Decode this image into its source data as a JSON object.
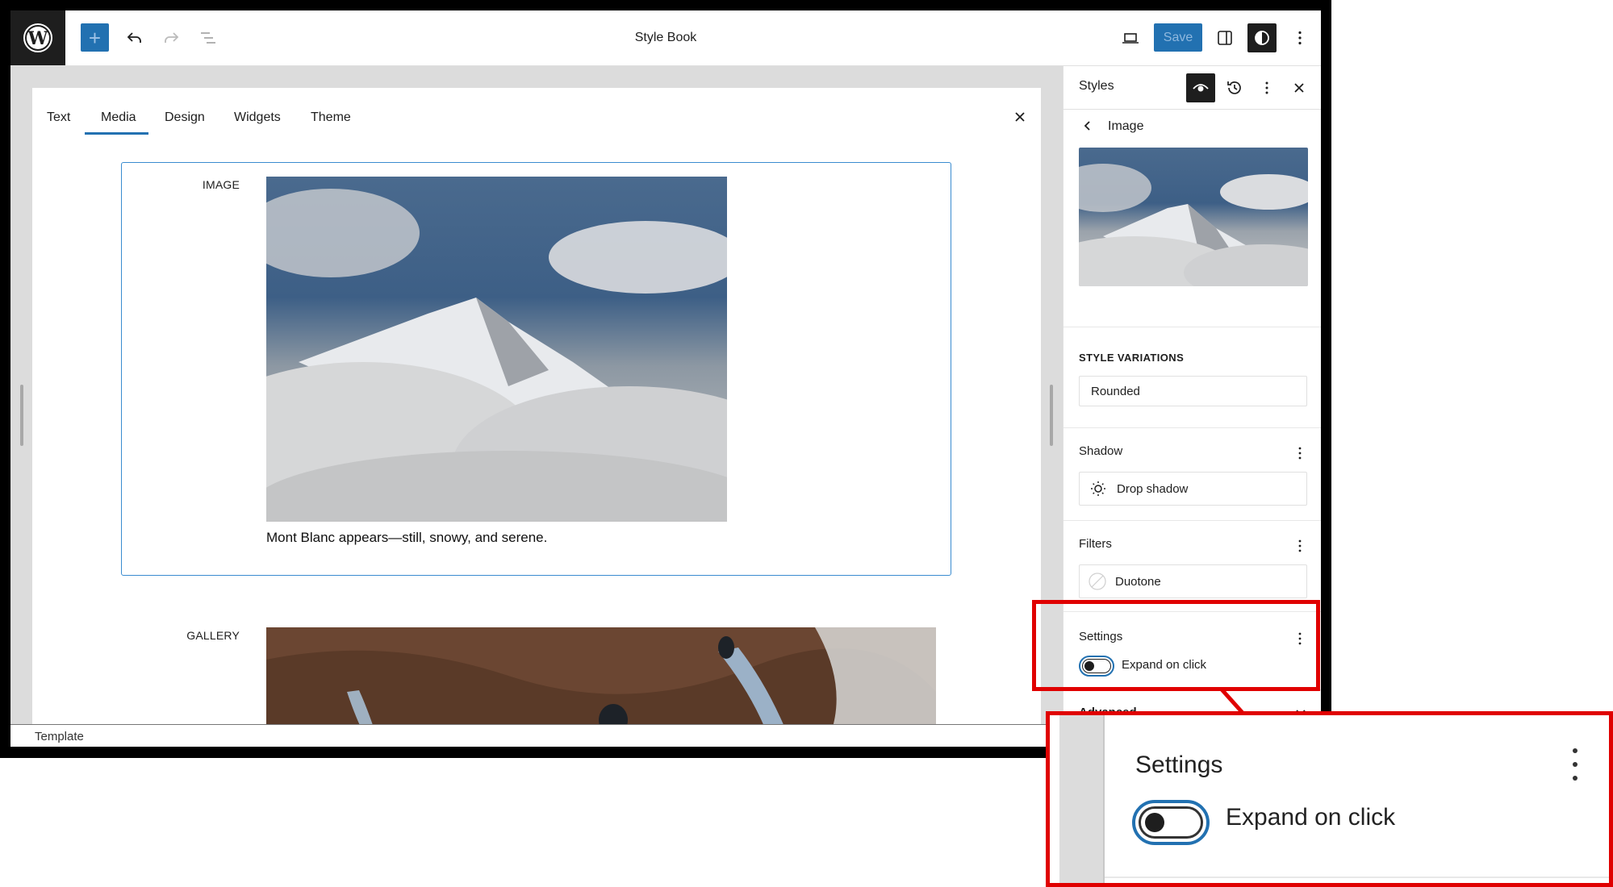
{
  "header": {
    "title": "Style Book",
    "save_label": "Save",
    "icons": {
      "logo": "wordpress-logo-icon",
      "inserter": "plus-icon",
      "undo": "undo-icon",
      "redo": "redo-icon",
      "list_view": "list-view-icon",
      "preview": "laptop-icon",
      "sidebar": "sidebar-toggle-icon",
      "styles": "half-circle-contrast-icon",
      "options": "kebab-menu-icon"
    },
    "colors": {
      "accent": "#2271b1",
      "dark": "#1e1e1e"
    }
  },
  "style_book": {
    "tabs": [
      {
        "label": "Text",
        "active": false
      },
      {
        "label": "Media",
        "active": true
      },
      {
        "label": "Design",
        "active": false
      },
      {
        "label": "Widgets",
        "active": false
      },
      {
        "label": "Theme",
        "active": false
      }
    ],
    "close_icon": "close-icon",
    "sections": [
      {
        "label": "Image",
        "caption": "Mont Blanc appears—still, snowy, and serene.",
        "selected": true
      },
      {
        "label": "Gallery"
      }
    ]
  },
  "footer": {
    "breadcrumb": "Template"
  },
  "sidebar": {
    "title": "Styles",
    "header_icons": [
      "eye-icon",
      "history-icon",
      "kebab-menu-icon",
      "close-icon"
    ],
    "nav_title": "Image",
    "style_variations": {
      "heading": "Style Variations",
      "value": "Rounded"
    },
    "shadow": {
      "heading": "Shadow",
      "item": "Drop shadow"
    },
    "filters": {
      "heading": "Filters",
      "item": "Duotone"
    },
    "settings": {
      "heading": "Settings",
      "toggle_label": "Expand on click",
      "toggle_on": false
    },
    "advanced": {
      "heading": "Advanced"
    }
  },
  "callout": {
    "title": "Settings",
    "toggle_label": "Expand on click",
    "highlight_color": "#e00000"
  }
}
